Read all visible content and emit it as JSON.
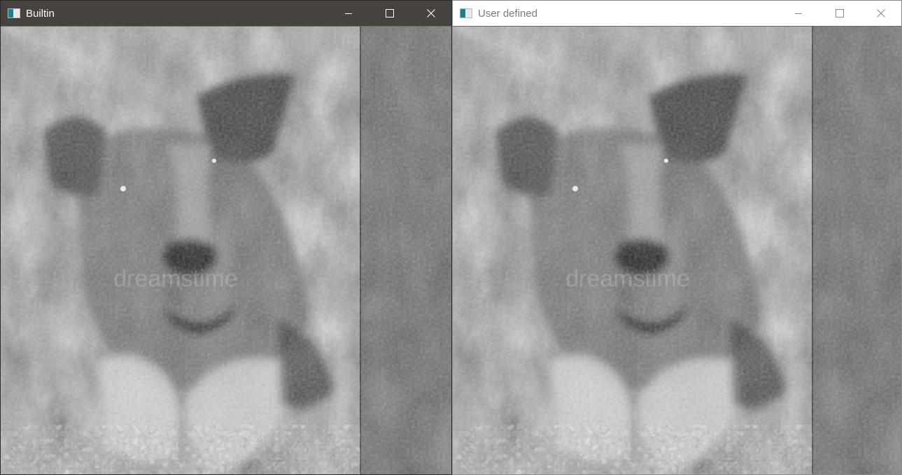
{
  "windows": {
    "left": {
      "title": "Builtin",
      "app_icon": "window-app-icon",
      "controls": [
        "minimize-icon",
        "maximize-icon",
        "close-icon"
      ],
      "titlebar_color": "#46423d",
      "title_color": "#ffffff",
      "content": "grayscale filtered photo of a dog lying on gravel, looking at the camera"
    },
    "right": {
      "title": "User defined",
      "app_icon": "window-app-icon",
      "controls": [
        "minimize-icon",
        "maximize-icon",
        "close-icon"
      ],
      "titlebar_color": "#ffffff",
      "title_color": "#7a7a7a",
      "content": "grayscale filtered photo of a dog lying on gravel, looking at the camera"
    }
  },
  "image": {
    "watermark": "dreamstime"
  }
}
